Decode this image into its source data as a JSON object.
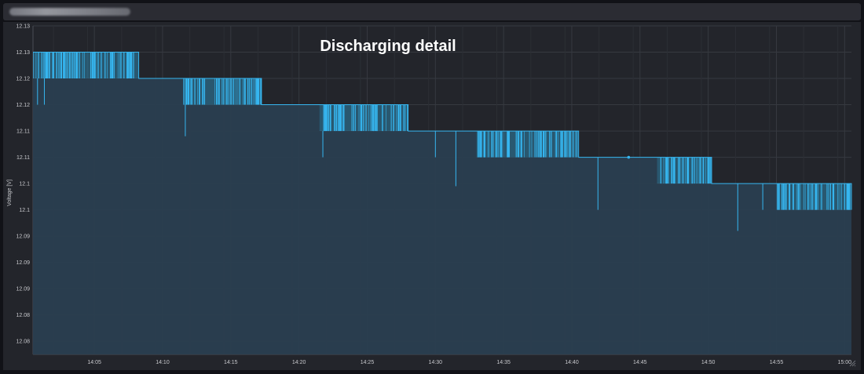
{
  "window": {
    "title": ""
  },
  "colors": {
    "background": "#23252b",
    "line": "#36b6f0",
    "fill": "#2a3e50",
    "grid": "#363940",
    "text": "#c8c9cd",
    "title": "#ffffff"
  },
  "chart_data": {
    "type": "area",
    "title": "Discharging detail",
    "xlabel": "",
    "ylabel": "Voltage [V]",
    "xlim": [
      "14:00:30",
      "15:00:30"
    ],
    "ylim": [
      12.075,
      12.1375
    ],
    "grid": true,
    "legend": "none",
    "y_tick_labels": [
      "12.08",
      "12.08",
      "12.09",
      "12.09",
      "12.09",
      "12.1",
      "12.1",
      "12.11",
      "12.11",
      "12.12",
      "12.12",
      "12.13",
      "12.13",
      "12.14"
    ],
    "x_tick_labels": [
      "14:05",
      "14:10",
      "14:15",
      "14:20",
      "14:25",
      "14:30",
      "14:35",
      "14:40",
      "14:45",
      "14:50",
      "14:55",
      "15:00"
    ],
    "series": [
      {
        "levels": [
          {
            "x_start": "14:00:30",
            "x_end": "14:08:15",
            "high": 12.1325,
            "low": 12.1275
          },
          {
            "x_start": "14:08:15",
            "x_end": "14:11:30",
            "high": 12.1275,
            "low": 12.1275
          },
          {
            "x_start": "14:11:30",
            "x_end": "14:17:15",
            "high": 12.1275,
            "low": 12.1225
          },
          {
            "x_start": "14:17:15",
            "x_end": "14:21:30",
            "high": 12.1225,
            "low": 12.1225
          },
          {
            "x_start": "14:21:30",
            "x_end": "14:28:00",
            "high": 12.1225,
            "low": 12.1175
          },
          {
            "x_start": "14:28:00",
            "x_end": "14:33:00",
            "high": 12.1175,
            "low": 12.1175
          },
          {
            "x_start": "14:33:00",
            "x_end": "14:40:30",
            "high": 12.1175,
            "low": 12.1125
          },
          {
            "x_start": "14:40:30",
            "x_end": "14:41:45",
            "high": 12.1125,
            "low": 12.1125
          },
          {
            "x_start": "14:41:45",
            "x_end": "14:46:15",
            "high": 12.1125,
            "low": 12.1125
          },
          {
            "x_start": "14:46:15",
            "x_end": "14:50:15",
            "high": 12.1125,
            "low": 12.1075
          },
          {
            "x_start": "14:50:15",
            "x_end": "14:52:00",
            "high": 12.1075,
            "low": 12.1075
          },
          {
            "x_start": "14:52:00",
            "x_end": "14:55:00",
            "high": 12.1075,
            "low": 12.1075
          },
          {
            "x_start": "14:55:00",
            "x_end": "15:00:30",
            "high": 12.1075,
            "low": 12.1025
          }
        ],
        "dips": [
          {
            "x": "14:00:50",
            "y": 12.1225
          },
          {
            "x": "14:01:20",
            "y": 12.1225
          },
          {
            "x": "14:11:40",
            "y": 12.1165
          },
          {
            "x": "14:21:45",
            "y": 12.1125
          },
          {
            "x": "14:30:00",
            "y": 12.1125
          },
          {
            "x": "14:31:30",
            "y": 12.107
          },
          {
            "x": "14:41:55",
            "y": 12.1025
          },
          {
            "x": "14:52:10",
            "y": 12.0985
          },
          {
            "x": "14:54:00",
            "y": 12.1025
          }
        ]
      }
    ]
  }
}
